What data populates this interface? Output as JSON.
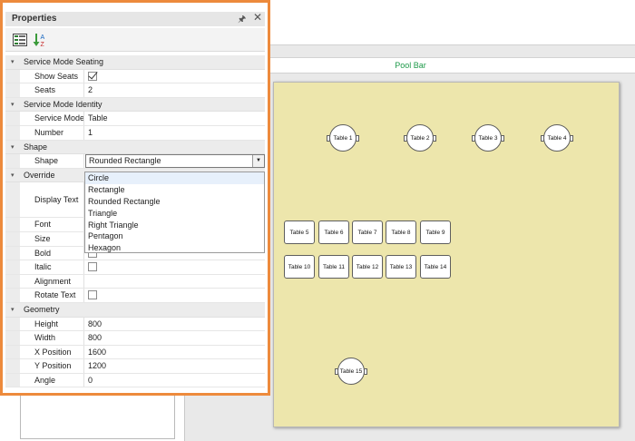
{
  "designer": {
    "title": "Pool Bar",
    "tables": [
      {
        "label": "Table 1",
        "shape": "round"
      },
      {
        "label": "Table 2",
        "shape": "round"
      },
      {
        "label": "Table 3",
        "shape": "round"
      },
      {
        "label": "Table 4",
        "shape": "round"
      },
      {
        "label": "Table 5",
        "shape": "rounded"
      },
      {
        "label": "Table 6",
        "shape": "rounded"
      },
      {
        "label": "Table 7",
        "shape": "rounded"
      },
      {
        "label": "Table 8",
        "shape": "rounded"
      },
      {
        "label": "Table 9",
        "shape": "rounded"
      },
      {
        "label": "Table 10",
        "shape": "rounded"
      },
      {
        "label": "Table 11",
        "shape": "rounded"
      },
      {
        "label": "Table 12",
        "shape": "rounded"
      },
      {
        "label": "Table 13",
        "shape": "rounded"
      },
      {
        "label": "Table 14",
        "shape": "rounded"
      },
      {
        "label": "Table 15",
        "shape": "round"
      }
    ]
  },
  "panel": {
    "title": "Properties",
    "pin_icon": "pin-icon",
    "close_icon": "close-icon",
    "toolbar": {
      "categorized_icon": "categorized-icon",
      "alphabetical_icon": "sort-alphabetical-icon"
    },
    "categories": {
      "seating": "Service Mode Seating",
      "identity": "Service Mode Identity",
      "shape": "Shape",
      "override": "Override",
      "geometry": "Geometry"
    },
    "props": {
      "show_seats": {
        "label": "Show Seats",
        "checked": true
      },
      "seats": {
        "label": "Seats",
        "value": "2"
      },
      "service_mode": {
        "label": "Service Mode",
        "value": "Table"
      },
      "number": {
        "label": "Number",
        "value": "1"
      },
      "shape": {
        "label": "Shape",
        "value": "Rounded Rectangle"
      },
      "display_text": {
        "label": "Display Text"
      },
      "font": {
        "label": "Font"
      },
      "size": {
        "label": "Size"
      },
      "bold": {
        "label": "Bold",
        "checked": false
      },
      "italic": {
        "label": "Italic",
        "checked": false
      },
      "alignment": {
        "label": "Alignment"
      },
      "rotate_text": {
        "label": "Rotate Text",
        "checked": false
      },
      "height": {
        "label": "Height",
        "value": "800"
      },
      "width": {
        "label": "Width",
        "value": "800"
      },
      "x_position": {
        "label": "X Position",
        "value": "1600"
      },
      "y_position": {
        "label": "Y Position",
        "value": "1200"
      },
      "angle": {
        "label": "Angle",
        "value": "0"
      }
    },
    "shape_options": [
      "Circle",
      "Rectangle",
      "Rounded Rectangle",
      "Triangle",
      "Right Triangle",
      "Pentagon",
      "Hexagon"
    ],
    "colors": {
      "accent_border": "#ed8a3c",
      "title_green": "#1f9a4a",
      "floor": "#ede6ac"
    }
  }
}
